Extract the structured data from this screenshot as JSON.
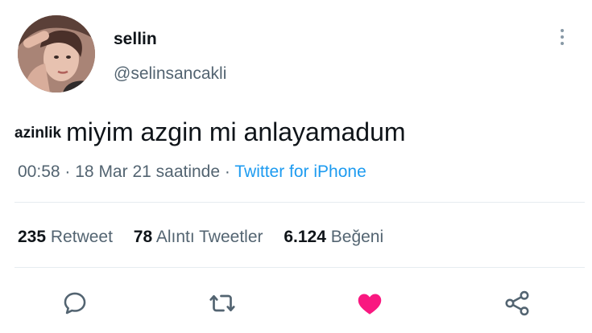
{
  "user": {
    "display_name": "sellin",
    "handle": "@selinsancakli"
  },
  "tweet": {
    "sticker_text": "azinlik",
    "text": "miyim azgin mi anlayamadum",
    "time": "00:58",
    "date": "18 Mar 21 saatinde",
    "separator": "·",
    "source": "Twitter for iPhone"
  },
  "stats": {
    "retweets_count": "235",
    "retweets_label": "Retweet",
    "quotes_count": "78",
    "quotes_label": "Alıntı Tweetler",
    "likes_count": "6.124",
    "likes_label": "Beğeni"
  },
  "colors": {
    "accent": "#1d9bf0",
    "like": "#f91880",
    "muted": "#536471"
  },
  "icons": [
    "reply-icon",
    "retweet-icon",
    "like-icon",
    "share-icon",
    "more-icon"
  ]
}
